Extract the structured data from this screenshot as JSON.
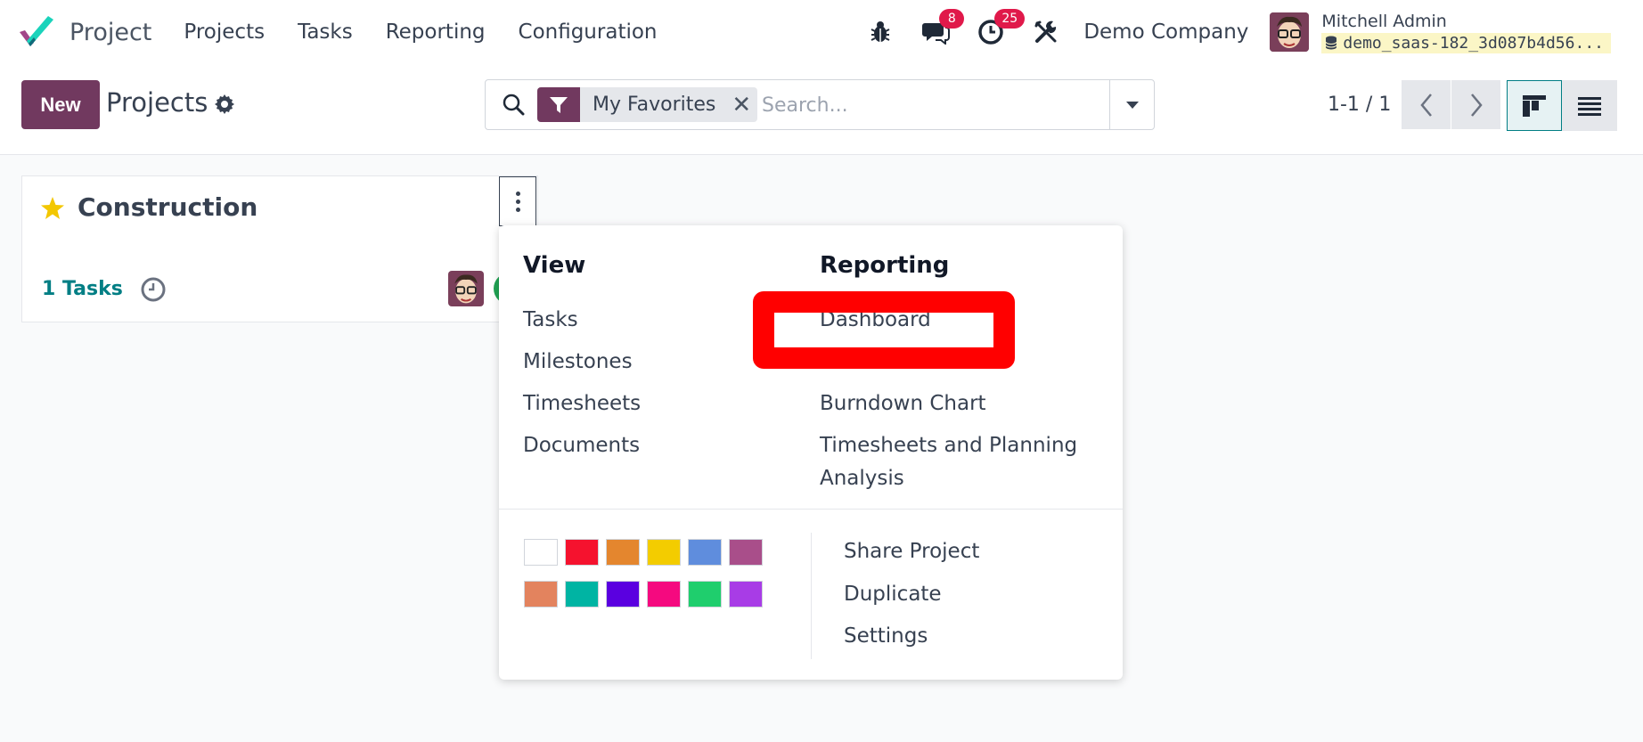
{
  "navbar": {
    "app_name": "Project",
    "menu": [
      "Projects",
      "Tasks",
      "Reporting",
      "Configuration"
    ],
    "messages_count": "8",
    "activities_count": "25",
    "company": "Demo Company",
    "user_name": "Mitchell Admin",
    "database": "demo_saas-182_3d087b4d56..."
  },
  "control": {
    "new_label": "New",
    "title": "Projects",
    "facet_label": "My Favorites",
    "search_placeholder": "Search...",
    "pager": "1-1 / 1"
  },
  "card": {
    "title": "Construction",
    "tasks": "1 Tasks"
  },
  "dropdown": {
    "view_heading": "View",
    "view_items": [
      "Tasks",
      "Milestones",
      "Timesheets",
      "Documents"
    ],
    "reporting_heading": "Reporting",
    "reporting_items": [
      "Dashboard",
      "Burndown Chart",
      "Timesheets and Planning",
      "Analysis"
    ],
    "actions": [
      "Share Project",
      "Duplicate",
      "Settings"
    ],
    "colors": [
      "#ffffff",
      "#f5122e",
      "#e4862e",
      "#f3cc00",
      "#5f8ddd",
      "#a94e8a",
      "#e3835e",
      "#00b4a3",
      "#5a00e0",
      "#f5097f",
      "#1fce6d",
      "#a83ce6"
    ]
  },
  "colors": {
    "brand": "#71395f",
    "accent": "#017e84",
    "badge": "#e0194a",
    "annotation": "#ff0000"
  }
}
